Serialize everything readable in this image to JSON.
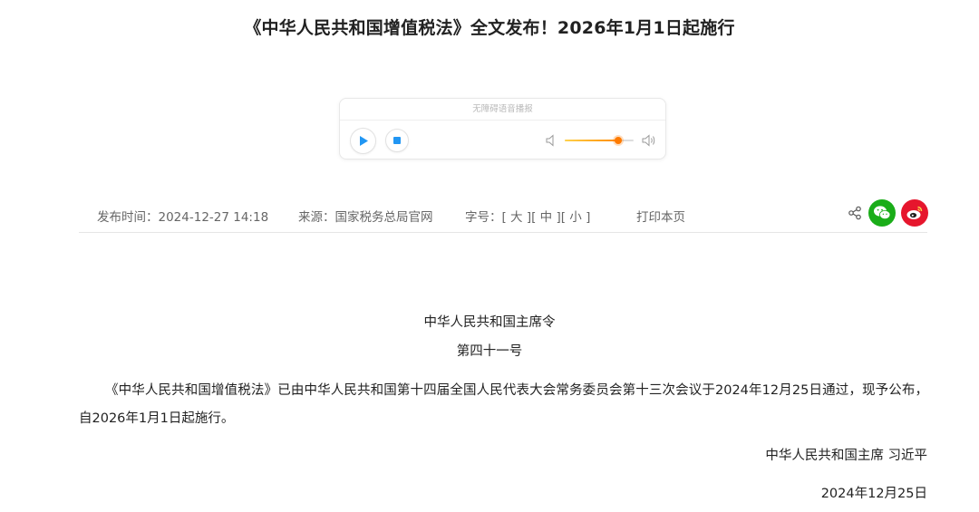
{
  "article": {
    "title": "《中华人民共和国增值税法》全文发布！2026年1月1日起施行"
  },
  "player": {
    "header": "无障碍语音播报",
    "volume_level": 0.78,
    "accent_color": "#ff8a00",
    "icons": [
      "play-icon",
      "stop-icon",
      "volume-low-icon",
      "volume-high-icon"
    ]
  },
  "meta": {
    "publish_label": "发布时间：",
    "publish_time": "2024-12-27 14:18",
    "source": "来源：国家税务总局官网",
    "font_label": "字号：",
    "font_large": "[ 大 ]",
    "font_medium": "[ 中 ]",
    "font_small": "[ 小 ]",
    "print": "打印本页",
    "share_icons": [
      "share-icon",
      "wechat-icon",
      "weibo-icon"
    ],
    "wechat_color": "#1aad19",
    "weibo_color": "#e6162d"
  },
  "body": {
    "order_title": "中华人民共和国主席令",
    "order_number": "第四十一号",
    "paragraph": "《中华人民共和国增值税法》已由中华人民共和国第十四届全国人民代表大会常务委员会第十三次会议于2024年12月25日通过，现予公布，自2026年1月1日起施行。",
    "signature": "中华人民共和国主席 习近平",
    "date": "2024年12月25日"
  }
}
